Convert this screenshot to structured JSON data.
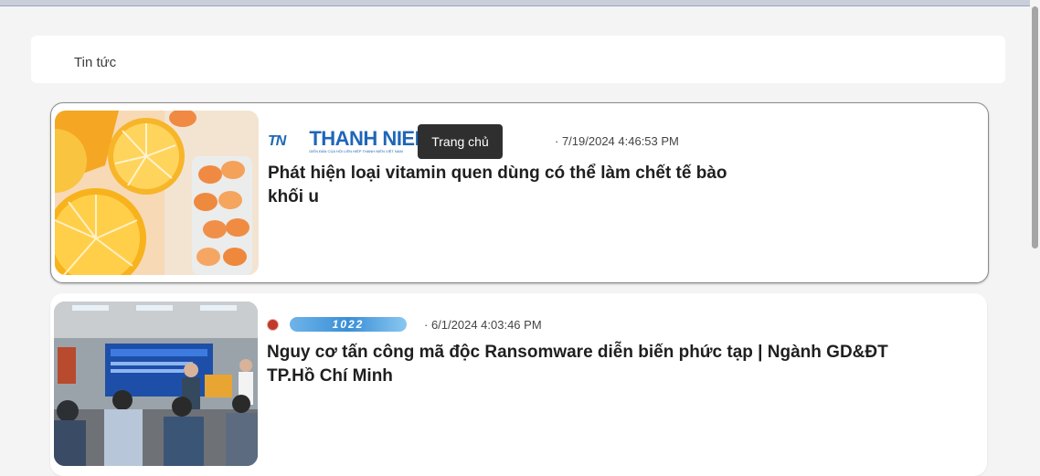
{
  "header": {
    "title": "Tin tức"
  },
  "tooltip": {
    "label": "Trang chủ"
  },
  "articles": [
    {
      "source_logo": "THANH NIEN",
      "source_mark": "TN",
      "source_tagline": "DIỄN ĐÀN CỦA HỘI LIÊN HIỆP THANH NIÊN VIỆT NAM",
      "date": "· 7/19/2024 4:46:53 PM",
      "title": "Phát hiện loại vitamin quen dùng có thể làm chết tế bào khối u",
      "thumbnail": "orange-vitamin-image"
    },
    {
      "source_logo": "1022",
      "date": "· 6/1/2024 4:03:46 PM",
      "title": "Nguy cơ tấn công mã độc Ransomware diễn biến phức tạp | Ngành GD&ĐT TP.Hồ Chí Minh",
      "thumbnail": "conference-image"
    }
  ]
}
